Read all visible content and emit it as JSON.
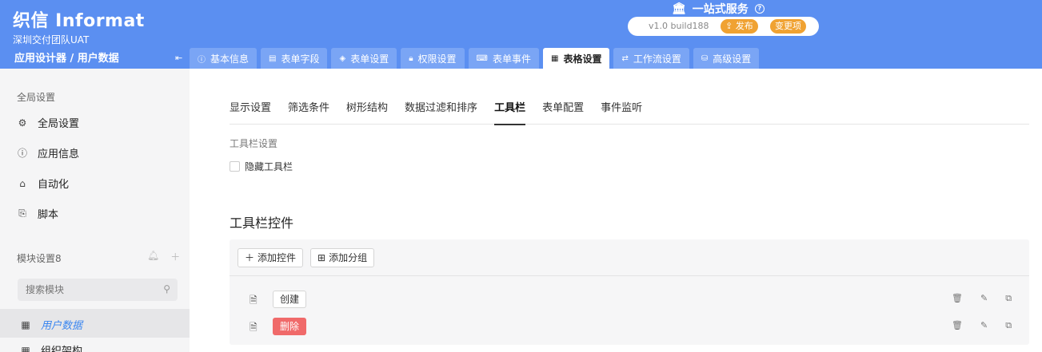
{
  "brand": {
    "name": "织信 Informat",
    "team": "深圳交付团队UAT"
  },
  "breadcrumb": "应用设计器 / 用户数据",
  "service": {
    "title": "一站式服务",
    "version": "v1.0 build188",
    "publish_label": "发布",
    "changes_label": "变更项"
  },
  "tabs": [
    {
      "label": "基本信息",
      "icon": "info-icon"
    },
    {
      "label": "表单字段",
      "icon": "form-icon"
    },
    {
      "label": "表单设置",
      "icon": "layers-icon"
    },
    {
      "label": "权限设置",
      "icon": "lock-icon"
    },
    {
      "label": "表单事件",
      "icon": "code-icon"
    },
    {
      "label": "表格设置",
      "icon": "table-icon",
      "active": true
    },
    {
      "label": "工作流设置",
      "icon": "workflow-icon"
    },
    {
      "label": "高级设置",
      "icon": "database-icon"
    }
  ],
  "sidebar": {
    "global_section": "全局设置",
    "global_items": [
      {
        "label": "全局设置",
        "icon": "gear-icon"
      },
      {
        "label": "应用信息",
        "icon": "info-icon"
      },
      {
        "label": "自动化",
        "icon": "robot-icon"
      },
      {
        "label": "脚本",
        "icon": "script-icon"
      }
    ],
    "module_section": "模块设置8",
    "search_placeholder": "搜索模块",
    "modules": [
      {
        "label": "用户数据",
        "icon": "table-icon",
        "active": true
      },
      {
        "label": "组织架构",
        "icon": "table-icon"
      }
    ]
  },
  "subtabs": [
    "显示设置",
    "筛选条件",
    "树形结构",
    "数据过滤和排序",
    "工具栏",
    "表单配置",
    "事件监听"
  ],
  "active_subtab": "工具栏",
  "toolbar_settings": {
    "label": "工具栏设置",
    "hide_toolbar_label": "隐藏工具栏",
    "hide_toolbar_checked": false
  },
  "controls": {
    "heading": "工具栏控件",
    "add_control_label": "添加控件",
    "add_group_label": "添加分组",
    "rows": [
      {
        "label": "创建",
        "style": "default"
      },
      {
        "label": "删除",
        "style": "danger"
      }
    ]
  }
}
